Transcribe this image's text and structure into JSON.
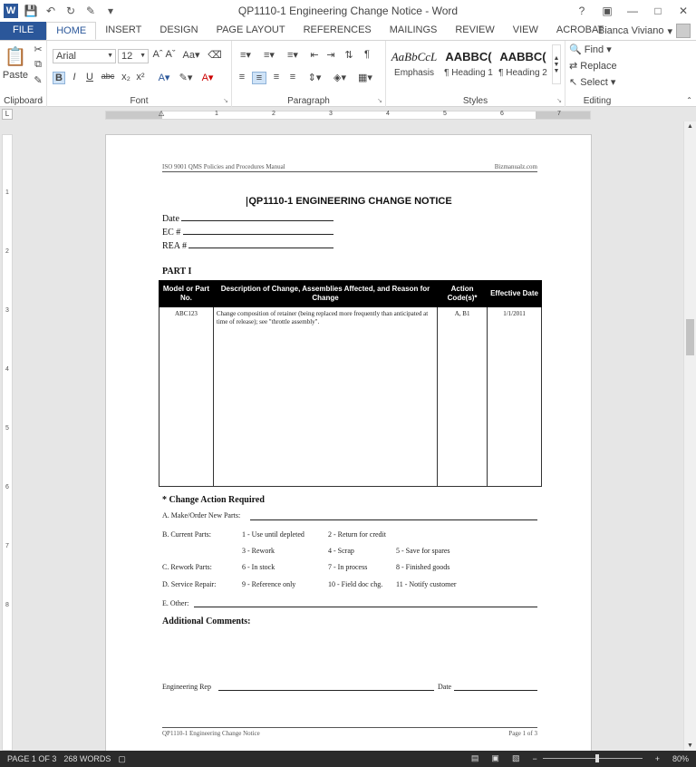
{
  "window": {
    "title": "QP1110-1 Engineering Change Notice - Word",
    "app_icon": "W"
  },
  "tabs": [
    {
      "label": "FILE"
    },
    {
      "label": "HOME"
    },
    {
      "label": "INSERT"
    },
    {
      "label": "DESIGN"
    },
    {
      "label": "PAGE LAYOUT"
    },
    {
      "label": "REFERENCES"
    },
    {
      "label": "MAILINGS"
    },
    {
      "label": "REVIEW"
    },
    {
      "label": "VIEW"
    },
    {
      "label": "ACROBAT"
    }
  ],
  "user": {
    "name": "Bianca Viviano"
  },
  "ribbon": {
    "clipboard": {
      "label": "Clipboard",
      "paste": "Paste"
    },
    "font": {
      "label": "Font",
      "family": "Arial",
      "size": "12"
    },
    "paragraph": {
      "label": "Paragraph"
    },
    "styles": {
      "label": "Styles",
      "items": [
        {
          "sample": "AaBbCcL",
          "name": "Emphasis"
        },
        {
          "sample": "AABBC(",
          "name": "¶ Heading 1"
        },
        {
          "sample": "AABBC(",
          "name": "¶ Heading 2"
        }
      ]
    },
    "editing": {
      "label": "Editing",
      "find": "Find",
      "replace": "Replace",
      "select": "Select"
    }
  },
  "ruler": {
    "marks": [
      "1",
      "2",
      "3",
      "4",
      "5",
      "6",
      "7"
    ]
  },
  "vruler": {
    "marks": [
      "1",
      "2",
      "3",
      "4",
      "5",
      "6",
      "7",
      "8"
    ]
  },
  "document": {
    "header_left": "ISO 9001 QMS Policies and Procedures Manual",
    "header_right": "Bizmanualz.com",
    "title": "QP1110-1 ENGINEERING CHANGE NOTICE",
    "fields": {
      "date": "Date",
      "ec": "EC #",
      "rea": "REA #"
    },
    "part": "PART I",
    "table": {
      "headers": [
        "Model or Part No.",
        "Description of Change, Assemblies Affected, and Reason for Change",
        "Action Code(s)*",
        "Effective Date"
      ],
      "row": {
        "model": "ABC123",
        "description": "Change composition of retainer (being replaced more frequently than anticipated at time of release); see \"throttle assembly\".",
        "action": "A, B1",
        "date": "1/1/2011"
      }
    },
    "change_action_title": "* Change Action Required",
    "make_order": "A. Make/Order New Parts:",
    "current_parts": "B. Current Parts:",
    "rework_parts": "C. Rework Parts:",
    "service_repair": "D. Service Repair:",
    "other": "E. Other:",
    "codes": {
      "c1": "1 - Use until depleted",
      "c2": "2 - Return for credit",
      "c3": "3 - Rework",
      "c4": "4 - Scrap",
      "c5": "5 - Save for spares",
      "c6": "6 - In stock",
      "c7": "7 - In process",
      "c8": "8 - Finished goods",
      "c9": "9 - Reference only",
      "c10": "10 - Field doc chg.",
      "c11": "11 - Notify customer"
    },
    "additional_comments": "Additional Comments:",
    "engineering_rep": "Engineering Rep",
    "date_label": "Date",
    "footer_left": "QP1110-1 Engineering Change Notice",
    "footer_right": "Page 1 of 3"
  },
  "status": {
    "page": "PAGE 1 OF 3",
    "words": "268 WORDS",
    "zoom": "80%"
  }
}
